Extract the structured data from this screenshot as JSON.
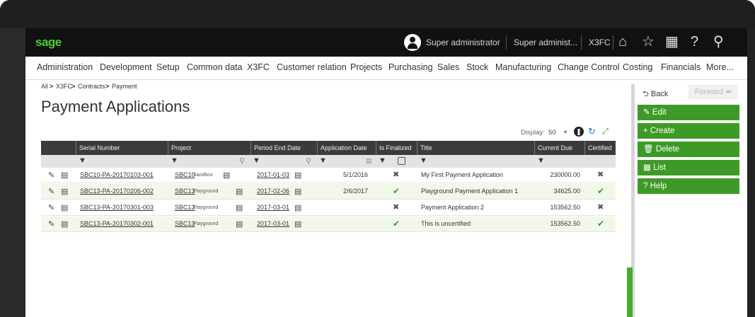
{
  "topbar": {
    "logo": "sage",
    "user": "Super administrator",
    "endpoint": "Super administ...",
    "folder": "X3FC",
    "icons": [
      "home-icon",
      "star-icon",
      "calculator-icon",
      "help-icon",
      "search-icon"
    ],
    "icon_glyphs": {
      "home": "⌂",
      "star": "☆",
      "calc": "▦",
      "help": "?",
      "search": "⚲"
    }
  },
  "menu": [
    "Administration",
    "Development",
    "Setup",
    "Common data",
    "X3FC",
    "Customer relation",
    "Projects",
    "Purchasing",
    "Sales",
    "Stock",
    "Manufacturing",
    "Change Control",
    "Costing",
    "Financials",
    "More..."
  ],
  "breadcrumb": [
    "All",
    "X3FC",
    "Contracts",
    "Payment"
  ],
  "breadcrumb_sep": ">",
  "page_title": "Payment Applications",
  "toolbar": {
    "display_label": "Display:",
    "display_value": "50"
  },
  "table": {
    "headers": [
      "Serial Number",
      "Project",
      "Period End Date",
      "Application Date",
      "Is Finalized",
      "Title",
      "Current Due",
      "Certified"
    ],
    "rows": [
      {
        "serial": "SBC10-PA-20170103-001",
        "project": "SBC10",
        "project_name": "Sandbox",
        "period_end": "2017-01-03",
        "app_date": "5/1/2016",
        "finalized": "x",
        "title": "My First Payment Application",
        "due": "230000.00",
        "certified": "x"
      },
      {
        "serial": "SBC13-PA-20170206-002",
        "project": "SBC13",
        "project_name": "Playground",
        "period_end": "2017-02-06",
        "app_date": "2/6/2017",
        "finalized": "check",
        "title": "Playground Payment Application 1",
        "due": "34625.00",
        "certified": "check"
      },
      {
        "serial": "SBC13-PA-20170301-003",
        "project": "SBC13",
        "project_name": "Playground",
        "period_end": "2017-03-01",
        "app_date": "",
        "finalized": "x",
        "title": "Payment Application 2",
        "due": "153562.50",
        "certified": "x"
      },
      {
        "serial": "SBC13-PA-20170302-001",
        "project": "SBC13",
        "project_name": "Playground",
        "period_end": "2017-03-01",
        "app_date": "",
        "finalized": "check",
        "title": "This is uncertified",
        "due": "153562.50",
        "certified": "check"
      }
    ]
  },
  "right_panel": {
    "back": "Back",
    "forward": "Forward",
    "actions": [
      "Edit",
      "Create",
      "Delete",
      "List",
      "Help"
    ],
    "action_glyphs": [
      "✎",
      "+",
      "🗑",
      "▦",
      "?"
    ]
  },
  "colors": {
    "brand": "#4ccf30",
    "action": "#3e9a27",
    "header": "#3b3b3b"
  }
}
